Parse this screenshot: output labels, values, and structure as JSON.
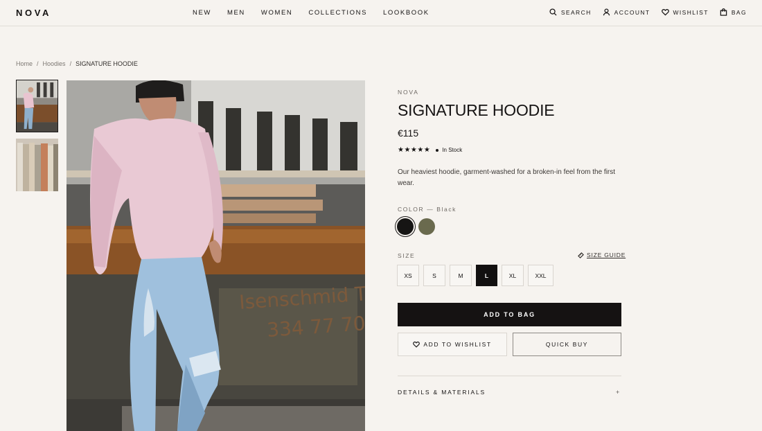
{
  "header": {
    "logo": "NOVA",
    "nav": [
      "NEW",
      "MEN",
      "WOMEN",
      "COLLECTIONS",
      "LOOKBOOK"
    ],
    "utilities": [
      {
        "label": "SEARCH",
        "icon": "search-icon"
      },
      {
        "label": "ACCOUNT",
        "icon": "user-icon"
      },
      {
        "label": "WISHLIST",
        "icon": "heart-icon"
      },
      {
        "label": "BAG",
        "icon": "bag-icon"
      }
    ]
  },
  "breadcrumb": {
    "home": "Home",
    "sep": "/",
    "category": "Hoodies",
    "current": "SIGNATURE HOODIE"
  },
  "product": {
    "brand": "NOVA",
    "title": "SIGNATURE HOODIE",
    "price": "€115",
    "rating": {
      "stars": "★★★★★",
      "value": 5,
      "max": 5
    },
    "stock": "In Stock",
    "description": "Our heaviest hoodie, garment-washed for a broken-in feel from the first wear.",
    "color_label": "COLOR — Black",
    "colors": [
      {
        "name": "Black",
        "hex": "#161514",
        "selected": true
      },
      {
        "name": "Olive",
        "hex": "#6a6a4e",
        "selected": false
      }
    ],
    "size_label": "SIZE",
    "size_guide": "SIZE GUIDE",
    "sizes": [
      "XS",
      "S",
      "M",
      "L",
      "XL",
      "XXL"
    ],
    "selected_size": "L",
    "add_to_bag": "ADD TO BAG",
    "add_to_wishlist": "ADD TO WISHLIST",
    "quick_buy": "QUICK BUY",
    "details_label": "DETAILS & MATERIALS",
    "details_toggle": "+"
  },
  "colors": {
    "background": "#f6f3ef",
    "primary": "#151212",
    "muted": "#6d6863"
  }
}
